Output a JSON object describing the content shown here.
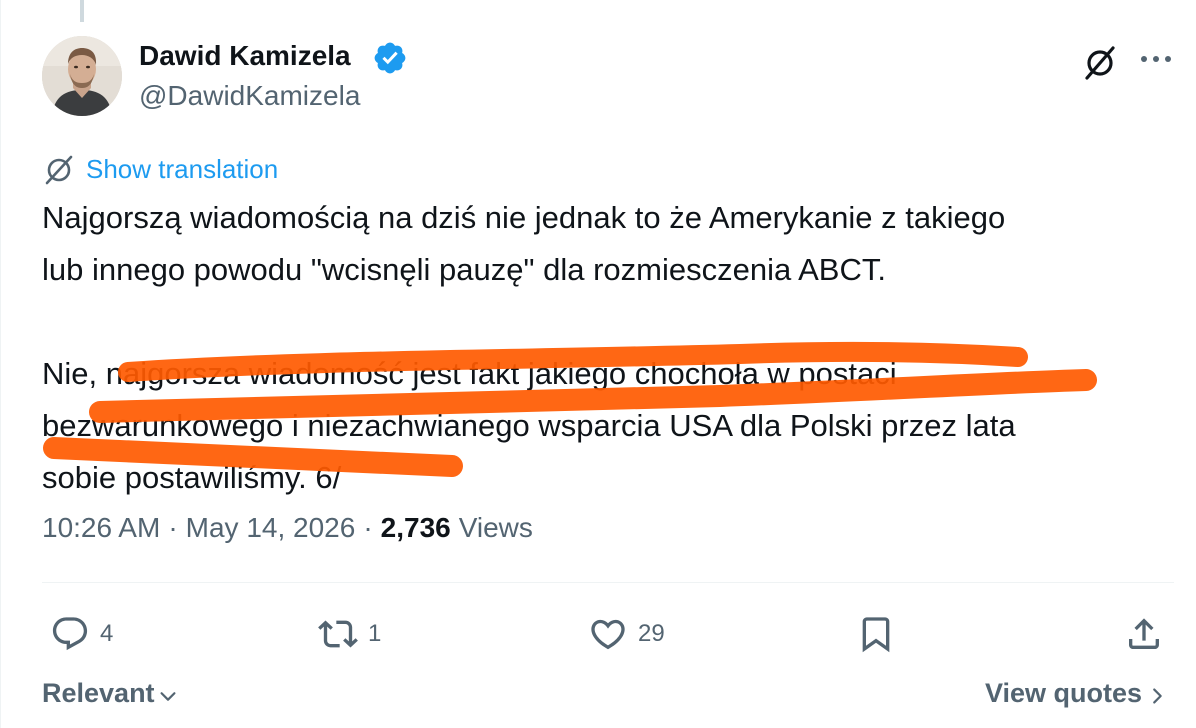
{
  "author": {
    "display_name": "Dawid Kamizela",
    "handle": "@DawidKamizela",
    "verified": true
  },
  "header_icons": {
    "grok": "grok-icon",
    "more": "more-icon"
  },
  "translation": {
    "label": "Show translation",
    "icon": "translate-icon"
  },
  "tweet": {
    "lines": [
      "Najgorszą wiadomością na dziś nie jednak to że Amerykanie z takiego",
      "lub innego powodu \"wcisnęli pauzę\" dla rozmiesczenia ABCT.",
      "Nie, najgorsza wiadomość jest fakt jakiego chochoła w postaci",
      "bezwarunkowego i niezachwianego wsparcia USA dla Polski przez lata",
      "sobie postawiliśmy. 6/"
    ],
    "highlight_color": "#ff5a00"
  },
  "meta": {
    "time": "10:26 AM",
    "separator": "·",
    "date": "May 14, 2026",
    "views_count": "2,736",
    "views_label": "Views"
  },
  "actions": {
    "replies": "4",
    "reposts": "1",
    "likes": "29"
  },
  "footer": {
    "sort_label": "Relevant",
    "view_quotes_label": "View quotes"
  },
  "colors": {
    "text": "#0f1419",
    "secondary": "#536471",
    "link": "#1d9bf0",
    "verified": "#1d9bf0",
    "divider": "#eff3f4"
  }
}
